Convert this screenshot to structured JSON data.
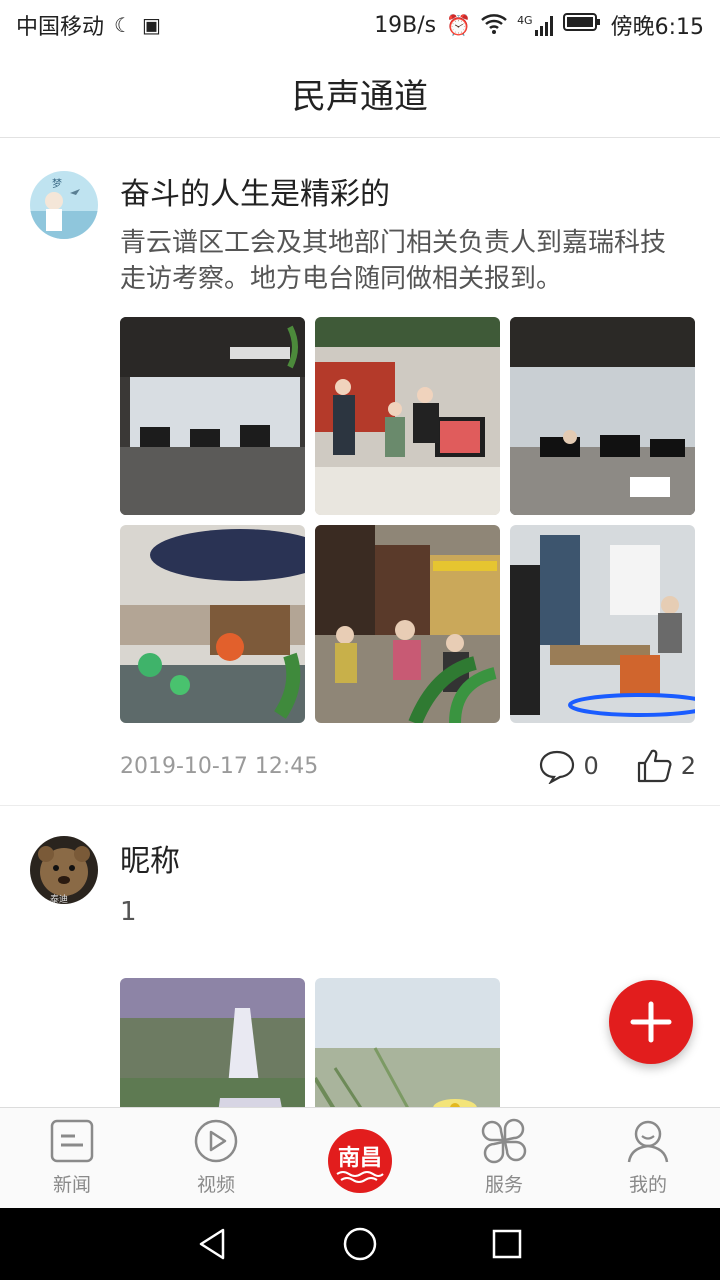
{
  "status_bar": {
    "carrier": "中国移动",
    "speed": "19B/s",
    "network": "4G",
    "time": "傍晚6:15"
  },
  "header": {
    "title": "民声通道"
  },
  "posts": [
    {
      "title": "奋斗的人生是精彩的",
      "body": "青云谱区工会及其地部门相关负责人到嘉瑞科技走访考察。地方电台随同做相关报到。",
      "timestamp": "2019-10-17 12:45",
      "comments": "0",
      "likes": "2"
    },
    {
      "title": "昵称",
      "body": "1"
    }
  ],
  "tabs": [
    {
      "label": "新闻",
      "icon": "news-icon"
    },
    {
      "label": "视频",
      "icon": "video-play-icon"
    },
    {
      "label": "",
      "icon": "nanchang-logo"
    },
    {
      "label": "服务",
      "icon": "services-grid-icon"
    },
    {
      "label": "我的",
      "icon": "profile-icon"
    }
  ],
  "colors": {
    "accent": "#e21d1d",
    "divider": "#e2e2e2",
    "muted": "#9a9a9a"
  }
}
